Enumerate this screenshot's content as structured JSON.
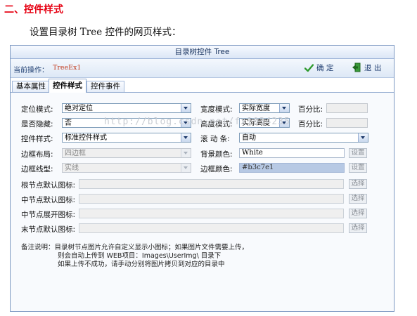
{
  "doc": {
    "heading": "二、控件样式",
    "intro": "设置目录树 Tree 控件的网页样式："
  },
  "window": {
    "title": "目录树控件 Tree"
  },
  "toolbar": {
    "current_op_label": "当前操作：",
    "current_op_value": "TreeEx1",
    "ok_label": "确 定",
    "exit_label": "退 出"
  },
  "tabs": [
    {
      "label": "基本属性",
      "active": false
    },
    {
      "label": "控件样式",
      "active": true
    },
    {
      "label": "控件事件",
      "active": false
    }
  ],
  "form": {
    "position_mode": {
      "label": "定位模式:",
      "value": "绝对定位"
    },
    "width_mode": {
      "label": "宽度模式:",
      "value": "实际宽度"
    },
    "width_percent": {
      "label": "百分比:",
      "value": ""
    },
    "hidden": {
      "label": "是否隐藏:",
      "value": "否"
    },
    "height_mode": {
      "label": "高度模式:",
      "value": "实际高度"
    },
    "height_percent": {
      "label": "百分比:",
      "value": ""
    },
    "control_style": {
      "label": "控件样式:",
      "value": "标准控件样式"
    },
    "scrollbar": {
      "label": "滚 动 条:",
      "value": "自动"
    },
    "border_layout": {
      "label": "边框布局:",
      "value": "四边框"
    },
    "bg_color": {
      "label": "背景颜色:",
      "value": "White",
      "button": "设置"
    },
    "border_line": {
      "label": "边框线型:",
      "value": "实线"
    },
    "border_color": {
      "label": "边框颜色:",
      "value": "#b3c7e1",
      "button": "设置"
    },
    "root_icon": {
      "label": "根节点默认图标:",
      "value": "",
      "button": "选择"
    },
    "mid_icon": {
      "label": "中节点默认图标:",
      "value": "",
      "button": "选择"
    },
    "mid_open_icon": {
      "label": "中节点展开图标:",
      "value": "",
      "button": "选择"
    },
    "leaf_icon": {
      "label": "末节点默认图标:",
      "value": "",
      "button": "选择"
    }
  },
  "notes": [
    "备注说明：目录树节点图片允许自定义显示小图标；如果图片文件需要上传，",
    "则会自动上传到  WEB项目：Images\\UserImg\\ 目录下",
    "如果上传不成功，请手动分别将图片拷贝到对应的目录中"
  ],
  "watermark": "http://blog.csdn.net/fx1034235",
  "colors": {
    "heading": "#e60012",
    "accent": "#b3c7e1"
  },
  "icons": {
    "ok": "checkmark-icon",
    "exit": "exit-door-icon"
  }
}
